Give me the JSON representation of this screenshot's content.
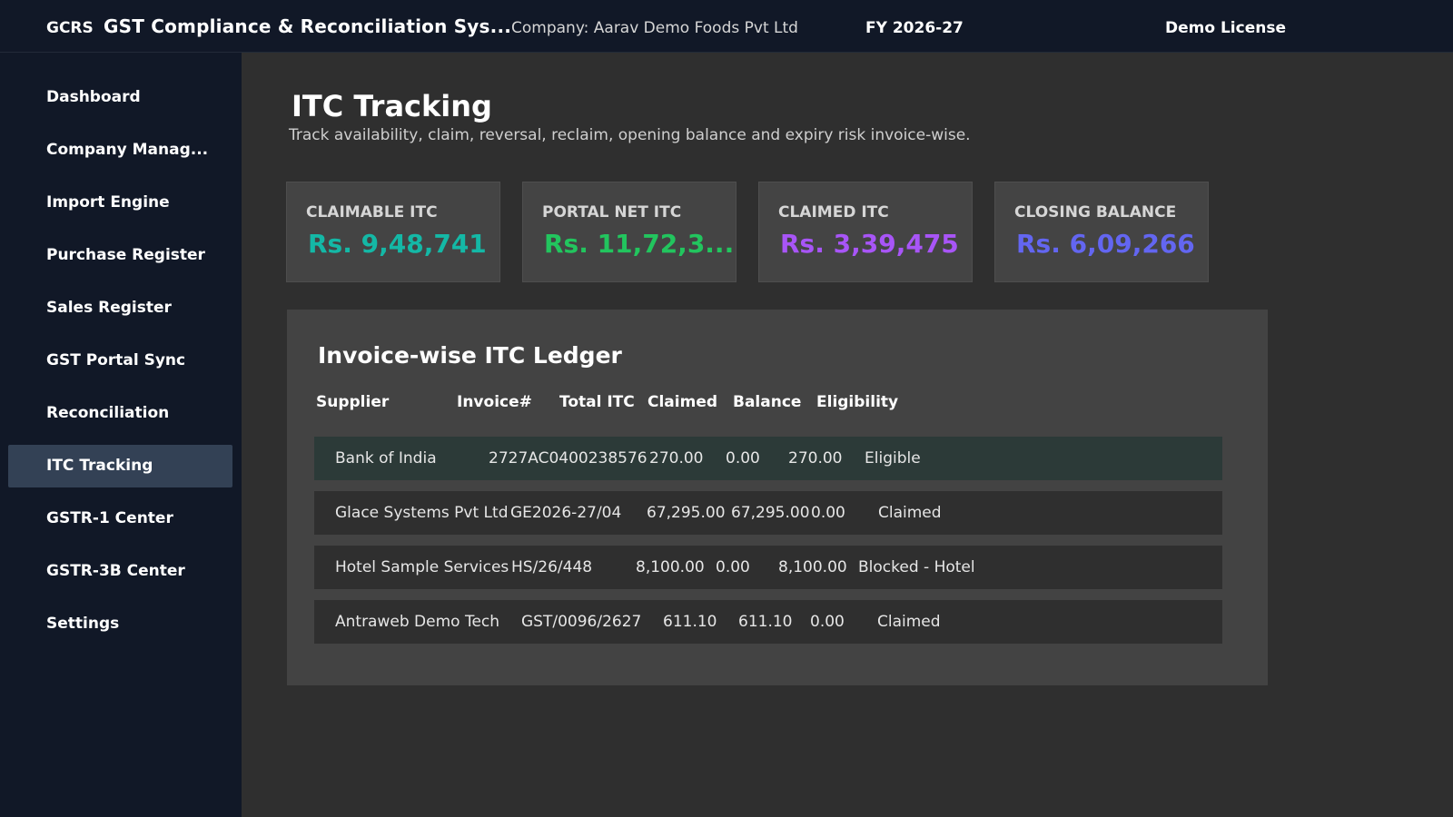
{
  "header": {
    "logo": "GCRS",
    "title": "GST Compliance & Reconciliation Sys...",
    "company": "Company: Aarav Demo Foods Pvt Ltd",
    "fy": "FY 2026-27",
    "license": "Demo License"
  },
  "sidebar": {
    "items": [
      {
        "label": "Dashboard"
      },
      {
        "label": "Company Manag..."
      },
      {
        "label": "Import Engine"
      },
      {
        "label": "Purchase Register"
      },
      {
        "label": "Sales Register"
      },
      {
        "label": "GST Portal Sync"
      },
      {
        "label": "Reconciliation"
      },
      {
        "label": "ITC Tracking"
      },
      {
        "label": "GSTR-1 Center"
      },
      {
        "label": "GSTR-3B Center"
      },
      {
        "label": "Settings"
      }
    ],
    "active": "ITC Tracking"
  },
  "page": {
    "title": "ITC Tracking",
    "subtitle": "Track availability, claim, reversal, reclaim, opening balance and expiry risk invoice-wise."
  },
  "cards": [
    {
      "label": "CLAIMABLE ITC",
      "value": "Rs. 9,48,741",
      "color": "#14b8a6"
    },
    {
      "label": "PORTAL NET ITC",
      "value": "Rs. 11,72,3...",
      "color": "#22c55e"
    },
    {
      "label": "CLAIMED ITC",
      "value": "Rs. 3,39,475",
      "color": "#a855f7"
    },
    {
      "label": "CLOSING BALANCE",
      "value": "Rs. 6,09,266",
      "color": "#6366f1"
    }
  ],
  "ledger": {
    "title": "Invoice-wise ITC Ledger",
    "columns": [
      "Supplier",
      "Invoice#",
      "Total ITC",
      "Claimed",
      "Balance",
      "Eligibility"
    ],
    "rows": [
      {
        "supplier": "Bank of India",
        "invoice": "2727AC0400238576",
        "total": "270.00",
        "claimed": "0.00",
        "balance": "270.00",
        "eligibility": "Eligible"
      },
      {
        "supplier": "Glace Systems Pvt Ltd",
        "invoice": "GE2026-27/04",
        "total": "67,295.00",
        "claimed": "67,295.00",
        "balance": "0.00",
        "eligibility": "Claimed"
      },
      {
        "supplier": "Hotel Sample Services",
        "invoice": "HS/26/448",
        "total": "8,100.00",
        "claimed": "0.00",
        "balance": "8,100.00",
        "eligibility": "Blocked - Hotel"
      },
      {
        "supplier": "Antraweb Demo Tech",
        "invoice": "GST/0096/2627",
        "total": "611.10",
        "claimed": "611.10",
        "balance": "0.00",
        "eligibility": "Claimed"
      }
    ]
  },
  "colors": {
    "topbar": "#111827",
    "sidebar": "#111827",
    "sidebar_active": "#334155",
    "content_bg": "#2f2f2f",
    "panel_bg": "#434343",
    "selected_row": "#2c3a38"
  }
}
